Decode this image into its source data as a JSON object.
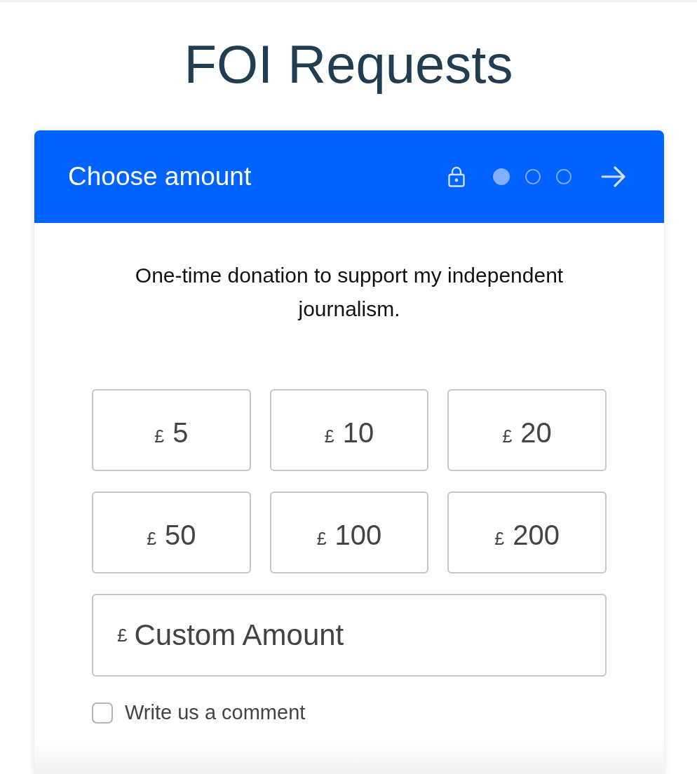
{
  "page_title": "FOI Requests",
  "donation_card": {
    "header": {
      "title": "Choose amount",
      "steps": [
        {
          "selected": true
        },
        {
          "selected": false
        },
        {
          "selected": false
        }
      ]
    },
    "description": "One-time donation to support my independent journalism.",
    "amounts": [
      {
        "currency": "£",
        "value": "5",
        "selected": false
      },
      {
        "currency": "£",
        "value": "10",
        "selected": false
      },
      {
        "currency": "£",
        "value": "20",
        "selected": false
      },
      {
        "currency": "£",
        "value": "50",
        "selected": false
      },
      {
        "currency": "£",
        "value": "100",
        "selected": false
      },
      {
        "currency": "£",
        "value": "200",
        "selected": false
      }
    ],
    "custom_amount": {
      "currency": "£",
      "placeholder": "Custom Amount"
    },
    "comment": {
      "label": "Write us a comment",
      "checked": false
    }
  }
}
